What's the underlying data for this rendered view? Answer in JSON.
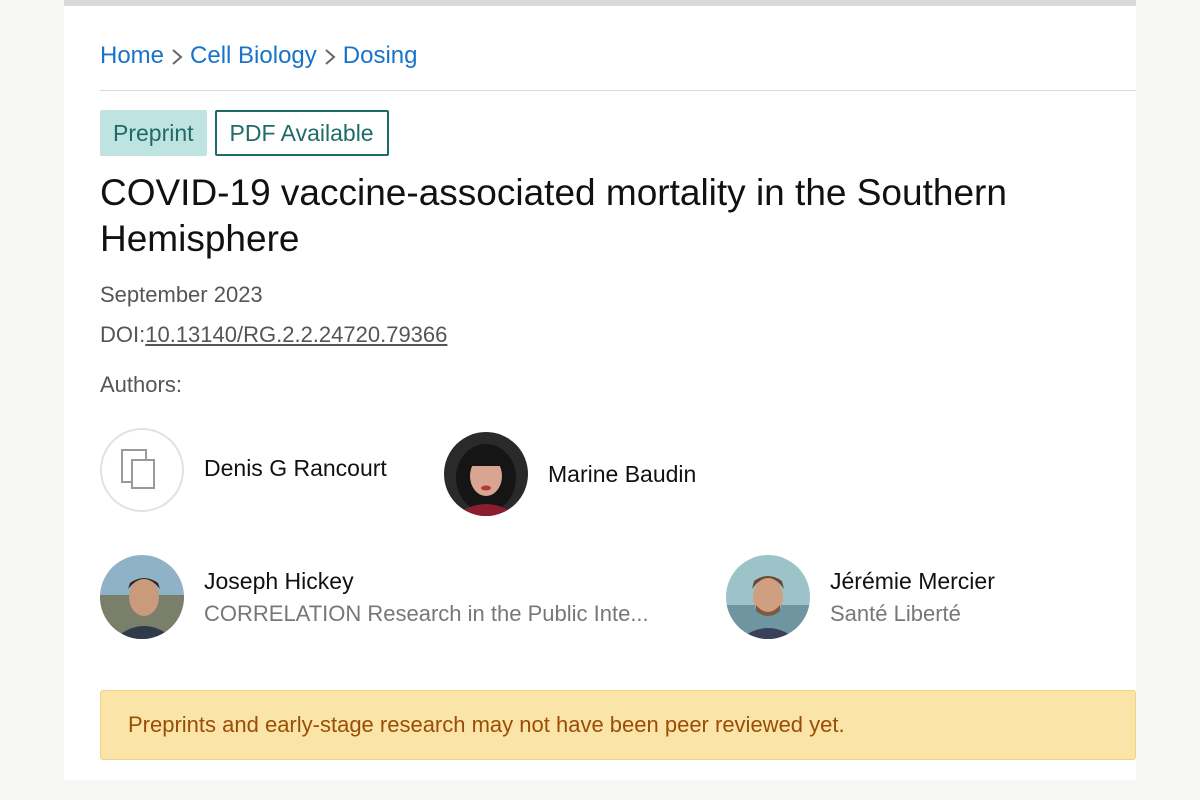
{
  "breadcrumb": {
    "items": [
      {
        "label": "Home"
      },
      {
        "label": "Cell Biology"
      },
      {
        "label": "Dosing"
      }
    ]
  },
  "badges": {
    "preprint": "Preprint",
    "pdf": "PDF Available"
  },
  "article": {
    "title": "COVID-19 vaccine-associated mortality in the Southern Hemisphere",
    "date": "September 2023",
    "doi_label": "DOI:",
    "doi_value": "10.13140/RG.2.2.24720.79366",
    "authors_label": "Authors:"
  },
  "authors": [
    {
      "name": "Denis G Rancourt",
      "affiliation": ""
    },
    {
      "name": "Marine Baudin",
      "affiliation": ""
    },
    {
      "name": "Joseph Hickey",
      "affiliation": "CORRELATION Research in the Public Inte..."
    },
    {
      "name": "Jérémie Mercier",
      "affiliation": "Santé Liberté"
    }
  ],
  "notice": {
    "text": "Preprints and early-stage research may not have been peer reviewed yet."
  },
  "colors": {
    "link": "#1a73c8",
    "badge_text": "#1f6b68",
    "badge_bg": "#bfe3e1",
    "notice_bg": "#fbe4a8",
    "notice_text": "#9a4d06"
  }
}
